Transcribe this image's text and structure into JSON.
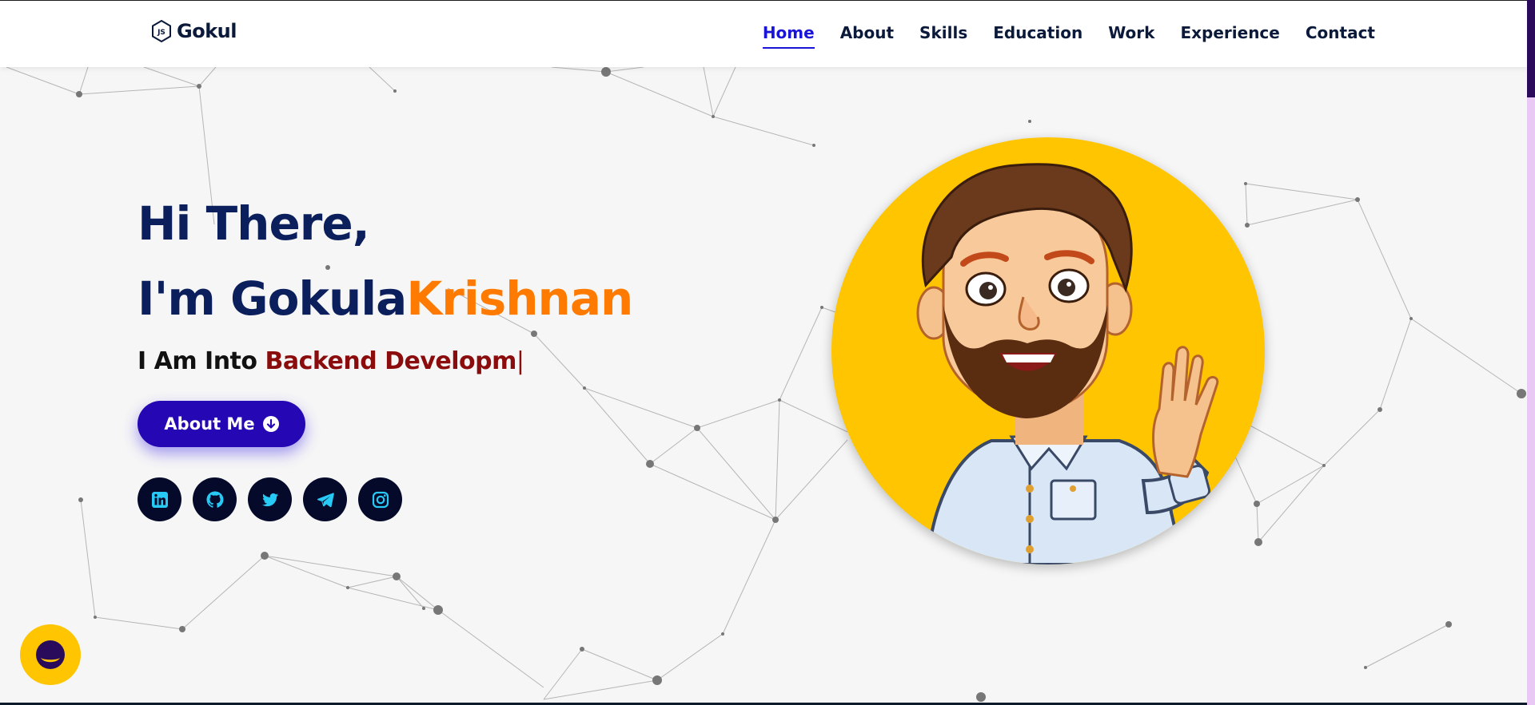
{
  "brand": {
    "name": "Gokul",
    "icon": "nodejs-hexagon-icon"
  },
  "nav": {
    "items": [
      {
        "label": "Home",
        "active": true
      },
      {
        "label": "About",
        "active": false
      },
      {
        "label": "Skills",
        "active": false
      },
      {
        "label": "Education",
        "active": false
      },
      {
        "label": "Work",
        "active": false
      },
      {
        "label": "Experience",
        "active": false
      },
      {
        "label": "Contact",
        "active": false
      }
    ]
  },
  "hero": {
    "greeting": "Hi There,",
    "intro_prefix": "I'm Gokula",
    "intro_accent": "Krishnan",
    "typed_prefix": "I Am Into",
    "typed_role": "Backend Developm",
    "typed_cursor": "|",
    "button_label": "About Me",
    "button_icon": "arrow-down-circle-icon"
  },
  "socials": [
    {
      "name": "linkedin",
      "icon": "linkedin-icon"
    },
    {
      "name": "github",
      "icon": "github-icon"
    },
    {
      "name": "twitter",
      "icon": "twitter-icon"
    },
    {
      "name": "telegram",
      "icon": "telegram-icon"
    },
    {
      "name": "instagram",
      "icon": "instagram-icon"
    }
  ],
  "avatar": {
    "description_icon": "waving-cartoon-avatar"
  },
  "chat": {
    "icon": "chat-bubble-icon"
  },
  "colors": {
    "nav_active": "#1a13d8",
    "heading": "#0b1f5c",
    "accent_orange": "#ff7a00",
    "role_red": "#8b0c0c",
    "button": "#2507b3",
    "avatar_bg": "#ffc500",
    "social_bg": "#050a2a",
    "social_icon": "#27c9f5"
  }
}
